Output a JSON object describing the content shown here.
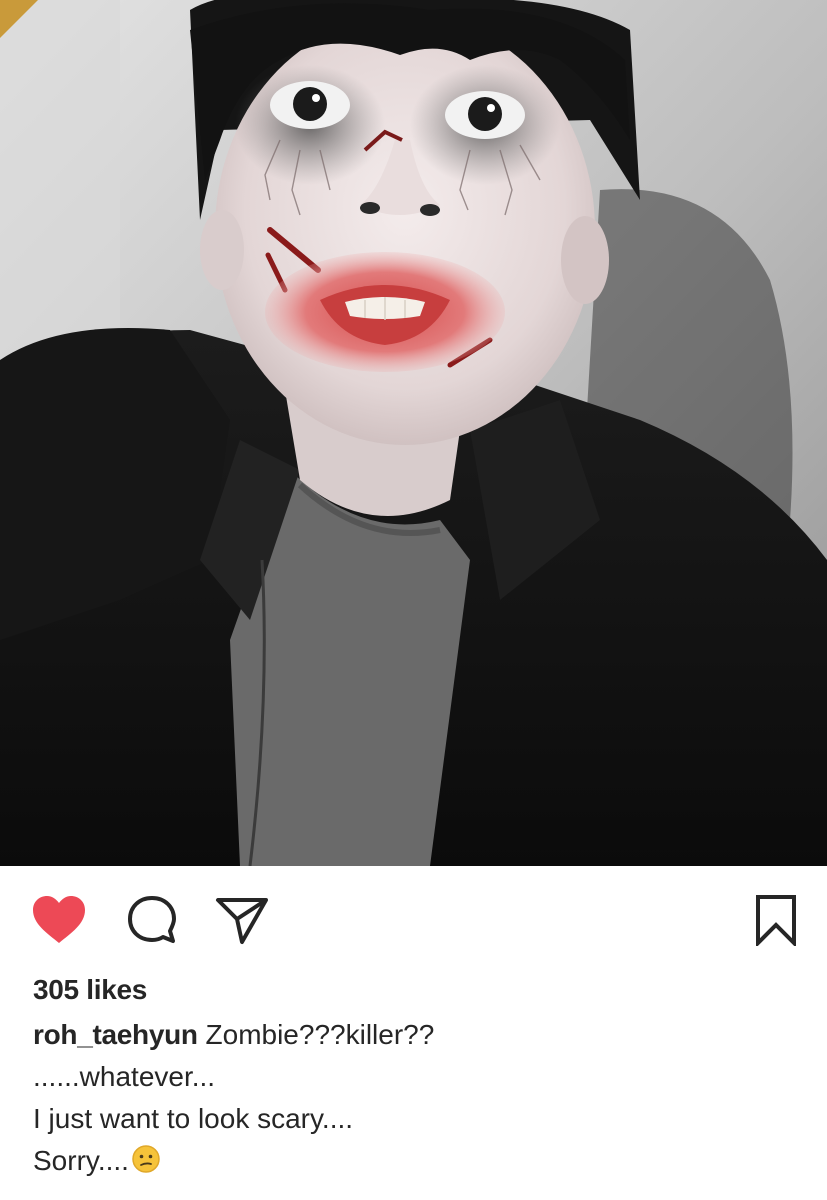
{
  "post": {
    "likes_text": "305 likes",
    "username": "roh_taehyun",
    "caption_first": "Zombie???killer??",
    "caption_lines": [
      "......whatever...",
      "I just want to look scary....",
      "Sorry...."
    ],
    "caption_emoji": "confused-face-emoji"
  },
  "actions": {
    "like_icon": "heart-icon",
    "like_state": "liked",
    "like_color": "#ed4956",
    "comment_icon": "comment-bubble-icon",
    "share_icon": "paper-plane-icon",
    "save_icon": "bookmark-icon"
  }
}
